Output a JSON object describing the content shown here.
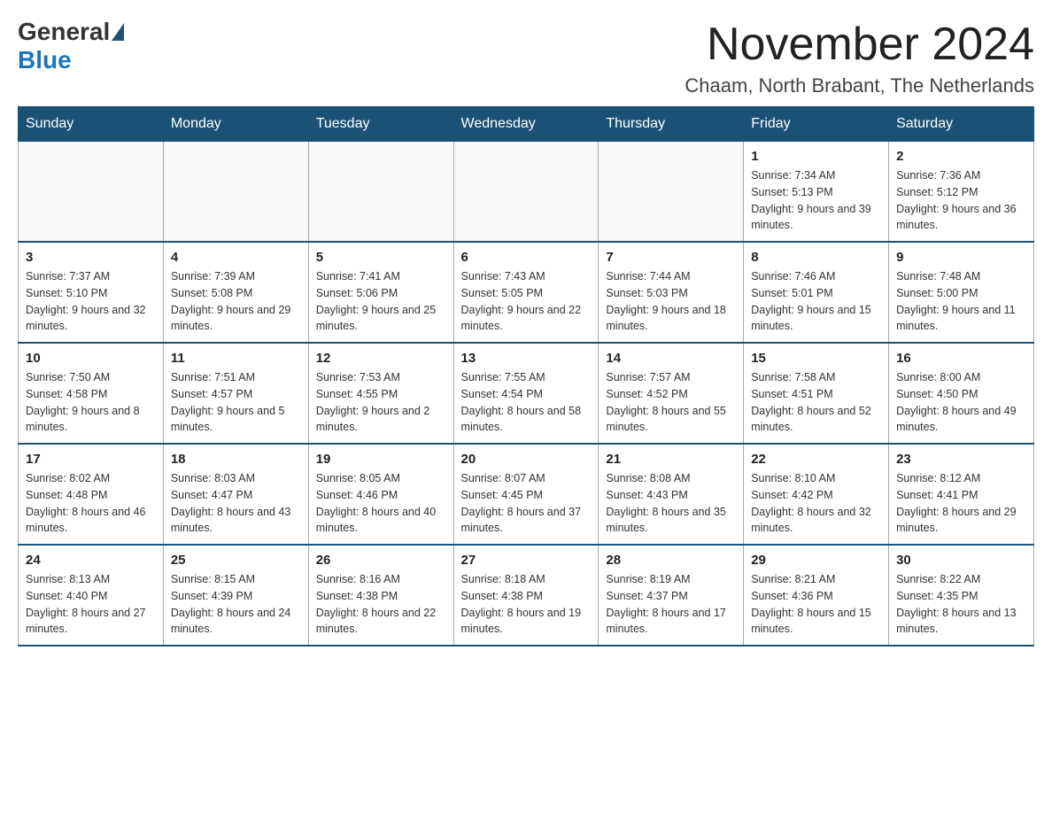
{
  "header": {
    "logo_general": "General",
    "logo_blue": "Blue",
    "month_year": "November 2024",
    "location": "Chaam, North Brabant, The Netherlands"
  },
  "days_of_week": [
    "Sunday",
    "Monday",
    "Tuesday",
    "Wednesday",
    "Thursday",
    "Friday",
    "Saturday"
  ],
  "weeks": [
    [
      {
        "day": "",
        "info": ""
      },
      {
        "day": "",
        "info": ""
      },
      {
        "day": "",
        "info": ""
      },
      {
        "day": "",
        "info": ""
      },
      {
        "day": "",
        "info": ""
      },
      {
        "day": "1",
        "info": "Sunrise: 7:34 AM\nSunset: 5:13 PM\nDaylight: 9 hours and 39 minutes."
      },
      {
        "day": "2",
        "info": "Sunrise: 7:36 AM\nSunset: 5:12 PM\nDaylight: 9 hours and 36 minutes."
      }
    ],
    [
      {
        "day": "3",
        "info": "Sunrise: 7:37 AM\nSunset: 5:10 PM\nDaylight: 9 hours and 32 minutes."
      },
      {
        "day": "4",
        "info": "Sunrise: 7:39 AM\nSunset: 5:08 PM\nDaylight: 9 hours and 29 minutes."
      },
      {
        "day": "5",
        "info": "Sunrise: 7:41 AM\nSunset: 5:06 PM\nDaylight: 9 hours and 25 minutes."
      },
      {
        "day": "6",
        "info": "Sunrise: 7:43 AM\nSunset: 5:05 PM\nDaylight: 9 hours and 22 minutes."
      },
      {
        "day": "7",
        "info": "Sunrise: 7:44 AM\nSunset: 5:03 PM\nDaylight: 9 hours and 18 minutes."
      },
      {
        "day": "8",
        "info": "Sunrise: 7:46 AM\nSunset: 5:01 PM\nDaylight: 9 hours and 15 minutes."
      },
      {
        "day": "9",
        "info": "Sunrise: 7:48 AM\nSunset: 5:00 PM\nDaylight: 9 hours and 11 minutes."
      }
    ],
    [
      {
        "day": "10",
        "info": "Sunrise: 7:50 AM\nSunset: 4:58 PM\nDaylight: 9 hours and 8 minutes."
      },
      {
        "day": "11",
        "info": "Sunrise: 7:51 AM\nSunset: 4:57 PM\nDaylight: 9 hours and 5 minutes."
      },
      {
        "day": "12",
        "info": "Sunrise: 7:53 AM\nSunset: 4:55 PM\nDaylight: 9 hours and 2 minutes."
      },
      {
        "day": "13",
        "info": "Sunrise: 7:55 AM\nSunset: 4:54 PM\nDaylight: 8 hours and 58 minutes."
      },
      {
        "day": "14",
        "info": "Sunrise: 7:57 AM\nSunset: 4:52 PM\nDaylight: 8 hours and 55 minutes."
      },
      {
        "day": "15",
        "info": "Sunrise: 7:58 AM\nSunset: 4:51 PM\nDaylight: 8 hours and 52 minutes."
      },
      {
        "day": "16",
        "info": "Sunrise: 8:00 AM\nSunset: 4:50 PM\nDaylight: 8 hours and 49 minutes."
      }
    ],
    [
      {
        "day": "17",
        "info": "Sunrise: 8:02 AM\nSunset: 4:48 PM\nDaylight: 8 hours and 46 minutes."
      },
      {
        "day": "18",
        "info": "Sunrise: 8:03 AM\nSunset: 4:47 PM\nDaylight: 8 hours and 43 minutes."
      },
      {
        "day": "19",
        "info": "Sunrise: 8:05 AM\nSunset: 4:46 PM\nDaylight: 8 hours and 40 minutes."
      },
      {
        "day": "20",
        "info": "Sunrise: 8:07 AM\nSunset: 4:45 PM\nDaylight: 8 hours and 37 minutes."
      },
      {
        "day": "21",
        "info": "Sunrise: 8:08 AM\nSunset: 4:43 PM\nDaylight: 8 hours and 35 minutes."
      },
      {
        "day": "22",
        "info": "Sunrise: 8:10 AM\nSunset: 4:42 PM\nDaylight: 8 hours and 32 minutes."
      },
      {
        "day": "23",
        "info": "Sunrise: 8:12 AM\nSunset: 4:41 PM\nDaylight: 8 hours and 29 minutes."
      }
    ],
    [
      {
        "day": "24",
        "info": "Sunrise: 8:13 AM\nSunset: 4:40 PM\nDaylight: 8 hours and 27 minutes."
      },
      {
        "day": "25",
        "info": "Sunrise: 8:15 AM\nSunset: 4:39 PM\nDaylight: 8 hours and 24 minutes."
      },
      {
        "day": "26",
        "info": "Sunrise: 8:16 AM\nSunset: 4:38 PM\nDaylight: 8 hours and 22 minutes."
      },
      {
        "day": "27",
        "info": "Sunrise: 8:18 AM\nSunset: 4:38 PM\nDaylight: 8 hours and 19 minutes."
      },
      {
        "day": "28",
        "info": "Sunrise: 8:19 AM\nSunset: 4:37 PM\nDaylight: 8 hours and 17 minutes."
      },
      {
        "day": "29",
        "info": "Sunrise: 8:21 AM\nSunset: 4:36 PM\nDaylight: 8 hours and 15 minutes."
      },
      {
        "day": "30",
        "info": "Sunrise: 8:22 AM\nSunset: 4:35 PM\nDaylight: 8 hours and 13 minutes."
      }
    ]
  ]
}
